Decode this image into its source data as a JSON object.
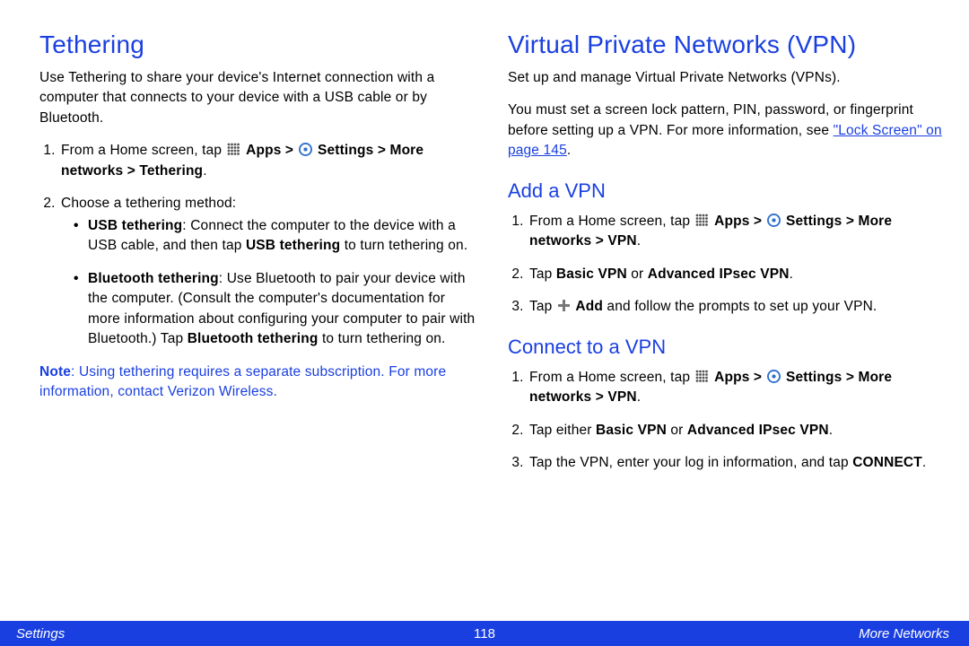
{
  "left": {
    "heading": "Tethering",
    "intro": "Use Tethering to share your device's Internet connection with a computer that connects to your device with a USB cable or by Bluetooth.",
    "step1_prefix": "From a Home screen, tap ",
    "step1_apps": "Apps > ",
    "step1_settings": "Settings > More networks > Tethering",
    "step2": "Choose a tethering method:",
    "usb_label": "USB tethering",
    "usb_body": ": Connect the computer to the device with a USB cable, and then tap ",
    "usb_bold2": "USB tethering",
    "usb_tail": " to turn tethering on.",
    "bt_label": "Bluetooth tethering",
    "bt_body": ": Use Bluetooth to pair your device with the computer. (Consult the computer's documentation for more information about configuring your computer to pair with Bluetooth.) Tap ",
    "bt_bold2": "Bluetooth tethering",
    "bt_tail": " to turn tethering on.",
    "note_label": "Note",
    "note_body": ": Using tethering requires a separate subscription. For more information, contact Verizon Wireless."
  },
  "right": {
    "heading": "Virtual Private Networks (VPN)",
    "intro1": "Set up and manage Virtual Private Networks (VPNs).",
    "intro2a": "You must set a screen lock pattern, PIN, password, or fingerprint before setting up a VPN. For more information, see ",
    "intro2_link": "\"Lock Screen\" on page 145",
    "intro2b": ".",
    "add_heading": "Add a VPN",
    "add1_prefix": "From a Home screen, tap ",
    "add1_apps": "Apps > ",
    "add1_settings": "Settings > More networks > VPN",
    "add2_pre": "Tap ",
    "add2_b1": "Basic VPN",
    "add2_mid": " or ",
    "add2_b2": "Advanced IPsec VPN",
    "add3_pre": "Tap ",
    "add3_bold": "Add",
    "add3_tail": " and follow the prompts to set up your VPN.",
    "conn_heading": "Connect to a VPN",
    "conn1_prefix": "From a Home screen, tap ",
    "conn1_apps": "Apps > ",
    "conn1_settings": "Settings > More networks > VPN",
    "conn2_pre": "Tap either ",
    "conn2_b1": "Basic VPN",
    "conn2_mid": " or ",
    "conn2_b2": "Advanced IPsec VPN",
    "conn3_pre": "Tap the VPN, enter your log in information, and tap ",
    "conn3_bold": "CONNECT"
  },
  "footer": {
    "left": "Settings",
    "page": "118",
    "right": "More Networks"
  }
}
